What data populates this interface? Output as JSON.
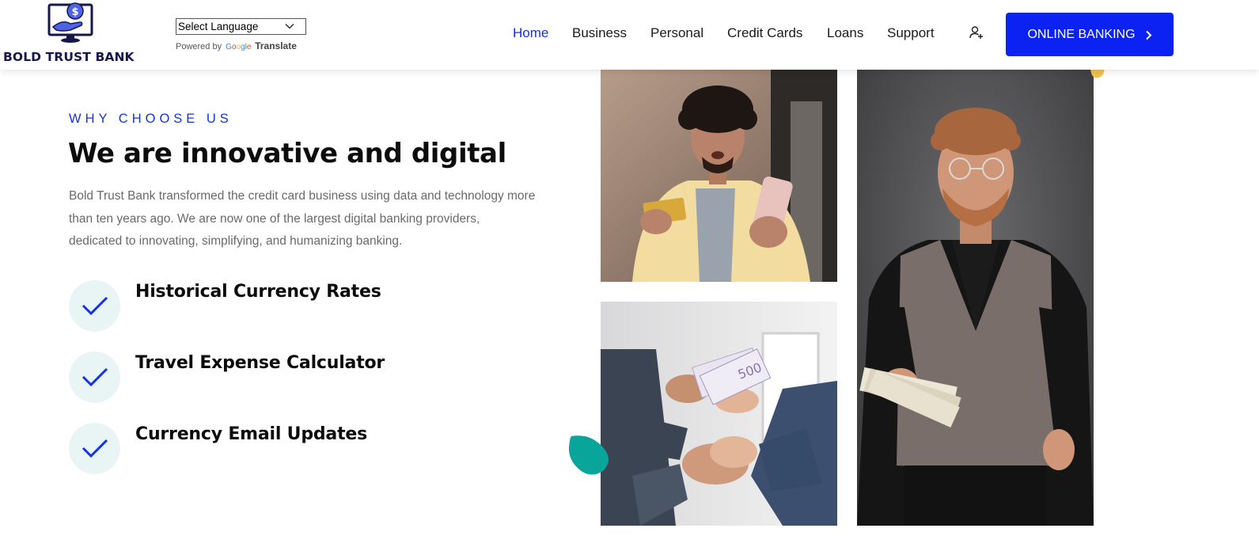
{
  "brand": {
    "name": "BOLD TRUST BANK",
    "logo_icon": "hand-coin-monitor-logo"
  },
  "translate": {
    "select_label": "Select Language",
    "powered_by": "Powered by",
    "google": "Google",
    "translate": "Translate"
  },
  "nav": {
    "items": [
      {
        "label": "Home",
        "active": true
      },
      {
        "label": "Business",
        "active": false
      },
      {
        "label": "Personal",
        "active": false
      },
      {
        "label": "Credit Cards",
        "active": false
      },
      {
        "label": "Loans",
        "active": false
      },
      {
        "label": "Support",
        "active": false
      }
    ],
    "user_icon": "user-plus-icon",
    "cta_label": "ONLINE BANKING"
  },
  "section": {
    "eyebrow": "WHY CHOOSE US",
    "title": "We are innovative and digital",
    "description": "Bold Trust Bank transformed the credit card business using data and technology more than ten years ago. We are now one of the largest digital banking providers, dedicated to innovating, simplifying, and humanizing banking.",
    "features": [
      {
        "label": "Historical Currency Rates",
        "icon": "check-icon"
      },
      {
        "label": "Travel Expense Calculator",
        "icon": "check-icon"
      },
      {
        "label": "Currency Email Updates",
        "icon": "check-icon"
      }
    ]
  },
  "images": [
    "man-with-credit-card-and-phone",
    "handshake-with-cash",
    "man-holding-cash"
  ],
  "colors": {
    "accent": "#1432e6",
    "button": "#0b22f2",
    "check_bg": "#e8f5f4",
    "teal": "#0aa59a",
    "yellow": "#f2c14e",
    "brand_text": "#17174a",
    "body_text": "#6a6a6a"
  }
}
